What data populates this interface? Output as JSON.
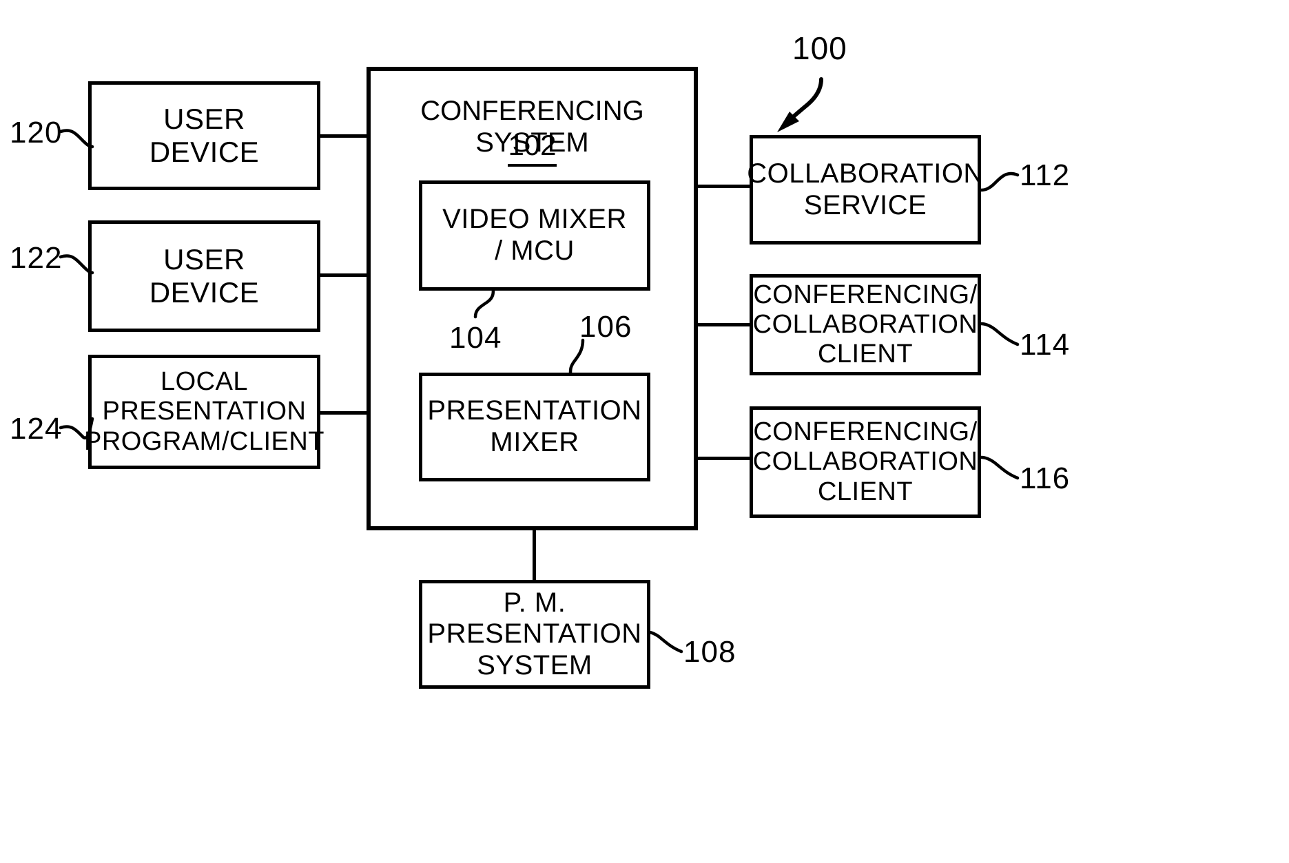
{
  "figure": {
    "overall_ref": "100",
    "background_color": "#ffffff",
    "line_color": "#000000"
  },
  "system": {
    "title": "CONFERENCING SYSTEM",
    "ref": "102"
  },
  "left_column": [
    {
      "id": "user-device-120",
      "label": "USER\nDEVICE",
      "ref": "120"
    },
    {
      "id": "user-device-122",
      "label": "USER\nDEVICE",
      "ref": "122"
    },
    {
      "id": "local-presentation-124",
      "label": "LOCAL\nPRESENTATION\nPROGRAM/CLIENT",
      "ref": "124"
    }
  ],
  "inner_modules": [
    {
      "id": "video-mixer-104",
      "label": "VIDEO MIXER\n/ MCU",
      "ref": "104"
    },
    {
      "id": "presentation-mixer-106",
      "label": "PRESENTATION\nMIXER",
      "ref": "106"
    }
  ],
  "right_column": [
    {
      "id": "collaboration-service-112",
      "label": "COLLABORATION\nSERVICE",
      "ref": "112"
    },
    {
      "id": "conferencing-client-114",
      "label": "CONFERENCING/\nCOLLABORATION\nCLIENT",
      "ref": "114"
    },
    {
      "id": "conferencing-client-116",
      "label": "CONFERENCING/\nCOLLABORATION\nCLIENT",
      "ref": "116"
    }
  ],
  "bottom": {
    "id": "pm-presentation-system-108",
    "label": "P. M.\nPRESENTATION\nSYSTEM",
    "ref": "108"
  }
}
